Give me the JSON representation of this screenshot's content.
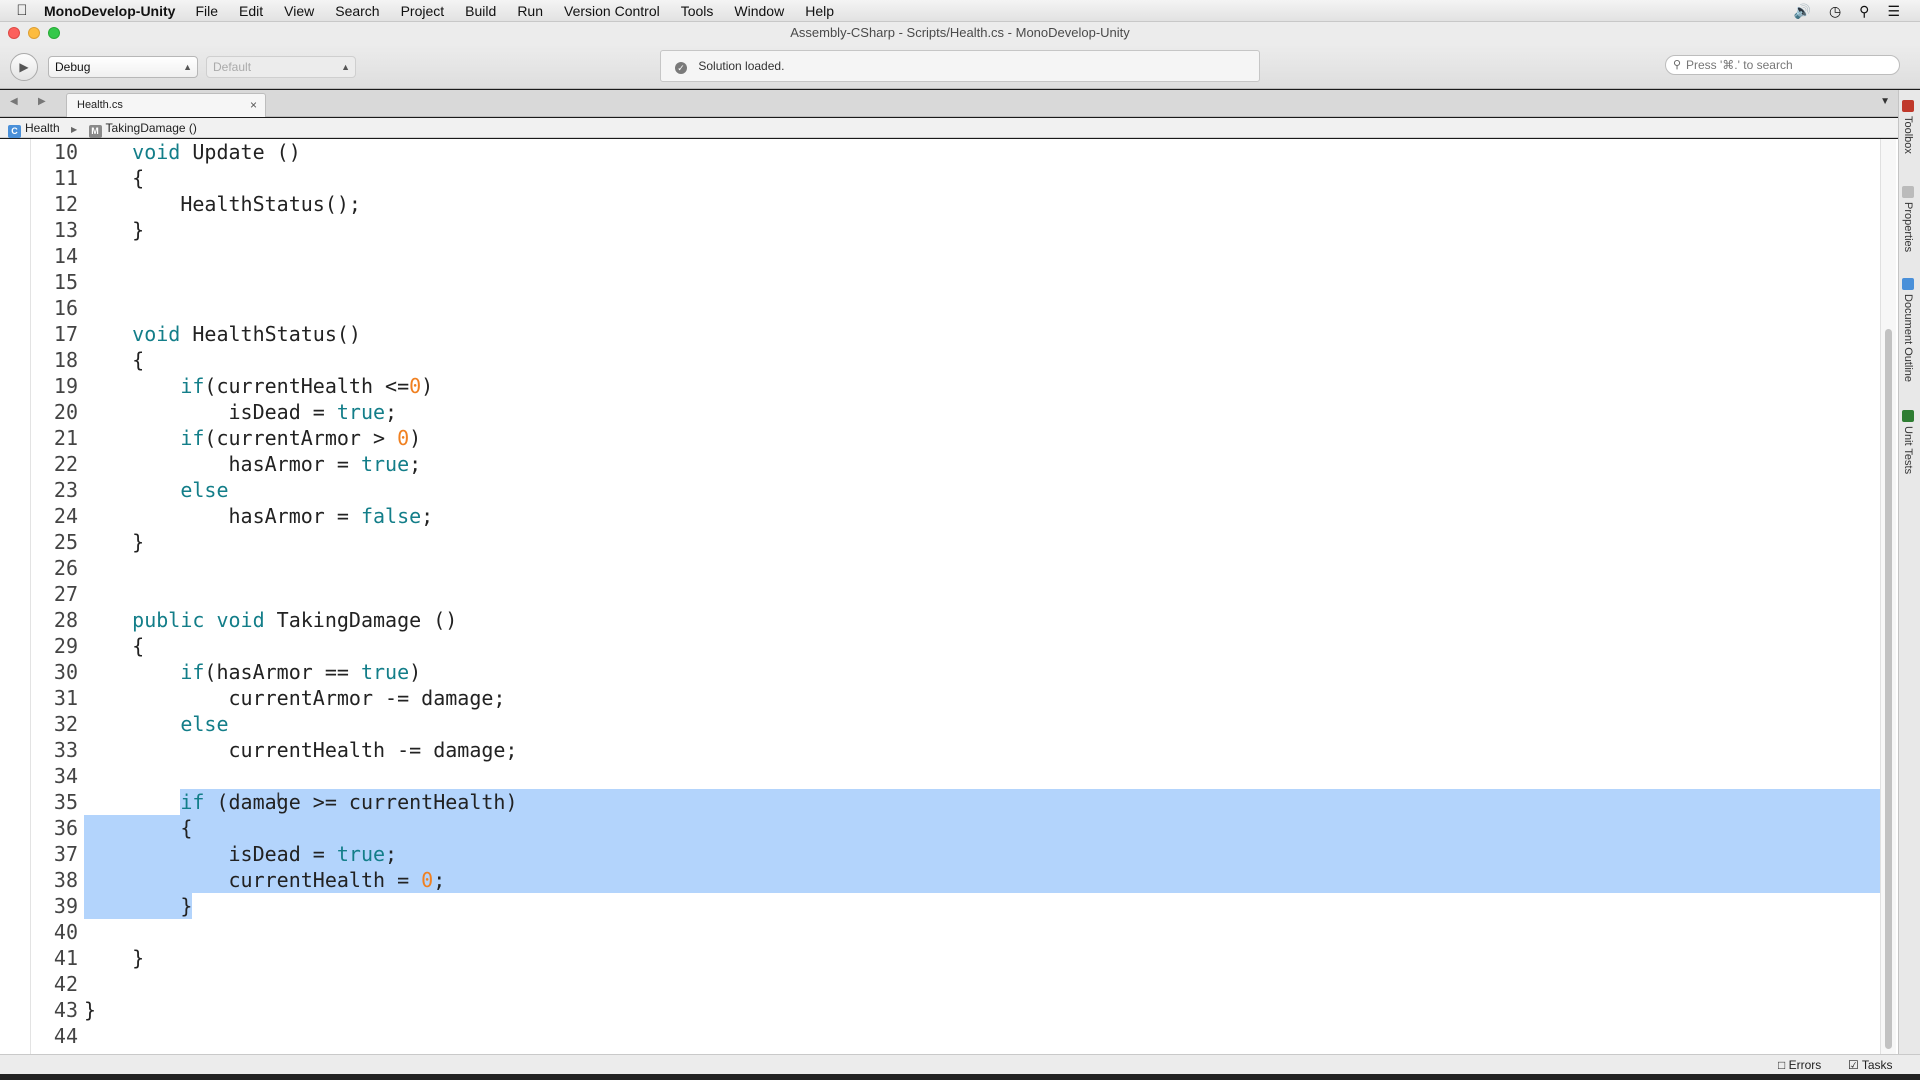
{
  "menubar": {
    "apple": "",
    "app_name": "MonoDevelop-Unity",
    "items": [
      "File",
      "Edit",
      "View",
      "Search",
      "Project",
      "Build",
      "Run",
      "Version Control",
      "Tools",
      "Window",
      "Help"
    ]
  },
  "window": {
    "title": "Assembly-CSharp - Scripts/Health.cs - MonoDevelop-Unity"
  },
  "toolbar": {
    "configuration": "Debug",
    "target": "Default",
    "status": "Solution loaded.",
    "search_placeholder": "Press '⌘.' to search"
  },
  "tabs": [
    {
      "label": "Health.cs"
    }
  ],
  "breadcrumb": {
    "class_name": "Health",
    "method_name": "TakingDamage ()"
  },
  "editor": {
    "lines": [
      {
        "n": "10",
        "segs": [
          [
            "p",
            "    "
          ],
          [
            "k",
            "void"
          ],
          [
            "p",
            " Update ()"
          ]
        ]
      },
      {
        "n": "11",
        "segs": [
          [
            "p",
            "    {"
          ]
        ]
      },
      {
        "n": "12",
        "segs": [
          [
            "p",
            "        HealthStatus();"
          ]
        ]
      },
      {
        "n": "13",
        "segs": [
          [
            "p",
            "    }"
          ]
        ]
      },
      {
        "n": "14",
        "segs": []
      },
      {
        "n": "15",
        "segs": []
      },
      {
        "n": "16",
        "segs": []
      },
      {
        "n": "17",
        "segs": [
          [
            "p",
            "    "
          ],
          [
            "k",
            "void"
          ],
          [
            "p",
            " HealthStatus()"
          ]
        ]
      },
      {
        "n": "18",
        "segs": [
          [
            "p",
            "    {"
          ]
        ]
      },
      {
        "n": "19",
        "segs": [
          [
            "p",
            "        "
          ],
          [
            "k",
            "if"
          ],
          [
            "p",
            "(currentHealth <="
          ],
          [
            "n",
            "0"
          ],
          [
            "p",
            ")"
          ]
        ]
      },
      {
        "n": "20",
        "segs": [
          [
            "p",
            "            isDead = "
          ],
          [
            "k",
            "true"
          ],
          [
            "p",
            ";"
          ]
        ]
      },
      {
        "n": "21",
        "segs": [
          [
            "p",
            "        "
          ],
          [
            "k",
            "if"
          ],
          [
            "p",
            "(currentArmor > "
          ],
          [
            "n",
            "0"
          ],
          [
            "p",
            ")"
          ]
        ]
      },
      {
        "n": "22",
        "segs": [
          [
            "p",
            "            hasArmor = "
          ],
          [
            "k",
            "true"
          ],
          [
            "p",
            ";"
          ]
        ]
      },
      {
        "n": "23",
        "segs": [
          [
            "p",
            "        "
          ],
          [
            "k",
            "else"
          ]
        ]
      },
      {
        "n": "24",
        "segs": [
          [
            "p",
            "            hasArmor = "
          ],
          [
            "k",
            "false"
          ],
          [
            "p",
            ";"
          ]
        ]
      },
      {
        "n": "25",
        "segs": [
          [
            "p",
            "    }"
          ]
        ]
      },
      {
        "n": "26",
        "segs": []
      },
      {
        "n": "27",
        "segs": []
      },
      {
        "n": "28",
        "segs": [
          [
            "p",
            "    "
          ],
          [
            "k",
            "public"
          ],
          [
            "p",
            " "
          ],
          [
            "k",
            "void"
          ],
          [
            "p",
            " TakingDamage ()"
          ]
        ]
      },
      {
        "n": "29",
        "segs": [
          [
            "p",
            "    {"
          ]
        ]
      },
      {
        "n": "30",
        "segs": [
          [
            "p",
            "        "
          ],
          [
            "k",
            "if"
          ],
          [
            "p",
            "(hasArmor == "
          ],
          [
            "k",
            "true"
          ],
          [
            "p",
            ")"
          ]
        ]
      },
      {
        "n": "31",
        "segs": [
          [
            "p",
            "            currentArmor -= damage;"
          ]
        ]
      },
      {
        "n": "32",
        "segs": [
          [
            "p",
            "        "
          ],
          [
            "k",
            "else"
          ]
        ]
      },
      {
        "n": "33",
        "segs": [
          [
            "p",
            "            currentHealth -= damage;"
          ]
        ]
      },
      {
        "n": "34",
        "segs": []
      },
      {
        "n": "35",
        "segs": [
          [
            "p",
            "        "
          ],
          [
            "k",
            "if"
          ],
          [
            "p",
            " (damage >= currentHealth)"
          ]
        ]
      },
      {
        "n": "36",
        "segs": [
          [
            "p",
            "        {"
          ]
        ]
      },
      {
        "n": "37",
        "segs": [
          [
            "p",
            "            isDead = "
          ],
          [
            "k",
            "true"
          ],
          [
            "p",
            ";"
          ]
        ]
      },
      {
        "n": "38",
        "segs": [
          [
            "p",
            "            currentHealth = "
          ],
          [
            "n",
            "0"
          ],
          [
            "p",
            ";"
          ]
        ]
      },
      {
        "n": "39",
        "segs": [
          [
            "p",
            "        }"
          ]
        ]
      },
      {
        "n": "40",
        "segs": []
      },
      {
        "n": "41",
        "segs": [
          [
            "p",
            "    }"
          ]
        ]
      },
      {
        "n": "42",
        "segs": []
      },
      {
        "n": "43",
        "segs": [
          [
            "p",
            "}"
          ]
        ]
      },
      {
        "n": "44",
        "segs": []
      }
    ],
    "selection": {
      "start_line": "35",
      "end_line": "39"
    }
  },
  "right_dock": [
    "Toolbox",
    "Properties",
    "Document Outline",
    "Unit Tests"
  ],
  "statusbar": {
    "errors_label": "Errors",
    "tasks_label": "Tasks"
  },
  "colors": {
    "keyword": "#137e89",
    "number": "#f08020",
    "selection": "#b3d4fc"
  }
}
